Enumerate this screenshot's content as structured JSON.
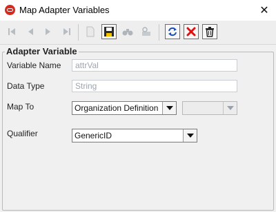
{
  "window": {
    "title": "Map Adapter Variables",
    "app_icon": "oracle-logo-icon",
    "close_symbol": "✕"
  },
  "toolbar": {
    "buttons": [
      {
        "name": "first-record-button",
        "icon": "first-icon",
        "enabled": false
      },
      {
        "name": "previous-record-button",
        "icon": "previous-icon",
        "enabled": false
      },
      {
        "name": "next-record-button",
        "icon": "next-icon",
        "enabled": false
      },
      {
        "name": "last-record-button",
        "icon": "last-icon",
        "enabled": false
      },
      {
        "name": "new-button",
        "icon": "new-document-icon",
        "enabled": false
      },
      {
        "name": "save-button",
        "icon": "floppy-disk-icon",
        "enabled": true
      },
      {
        "name": "find-button",
        "icon": "binoculars-icon",
        "enabled": false
      },
      {
        "name": "query-button",
        "icon": "query-icon",
        "enabled": false
      },
      {
        "name": "refresh-button",
        "icon": "refresh-icon",
        "enabled": true
      },
      {
        "name": "delete-button",
        "icon": "red-x-icon",
        "enabled": true
      },
      {
        "name": "trash-button",
        "icon": "trash-icon",
        "enabled": true
      }
    ]
  },
  "form": {
    "section_title": "Adapter Variable",
    "variable_name": {
      "label": "Variable Name",
      "value": "attrVal"
    },
    "data_type": {
      "label": "Data Type",
      "value": "String"
    },
    "map_to": {
      "label": "Map To",
      "value": "Organization Definition",
      "secondary_value": ""
    },
    "qualifier": {
      "label": "Qualifier",
      "value": "GenericID"
    }
  },
  "colors": {
    "delete_red": "#e01010",
    "refresh_blue": "#1b4fb5",
    "oracle_red": "#d52b1e"
  }
}
